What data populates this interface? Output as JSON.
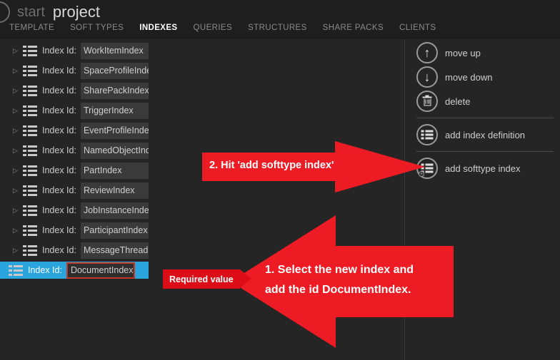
{
  "header": {
    "logo_icon": "circle-logo-icon",
    "title_prefix": "start",
    "title": "project",
    "tabs": [
      {
        "label": "TEMPLATE",
        "active": false
      },
      {
        "label": "SOFT TYPES",
        "active": false
      },
      {
        "label": "INDEXES",
        "active": true
      },
      {
        "label": "QUERIES",
        "active": false
      },
      {
        "label": "STRUCTURES",
        "active": false
      },
      {
        "label": "SHARE PACKS",
        "active": false
      },
      {
        "label": "CLIENTS",
        "active": false
      }
    ]
  },
  "index_list": {
    "row_label": "Index Id:",
    "rows": [
      {
        "value": "WorkItemIndex",
        "selected": false
      },
      {
        "value": "SpaceProfileIndex",
        "selected": false
      },
      {
        "value": "SharePackIndex",
        "selected": false
      },
      {
        "value": "TriggerIndex",
        "selected": false
      },
      {
        "value": "EventProfileIndex",
        "selected": false
      },
      {
        "value": "NamedObjectIndex",
        "selected": false
      },
      {
        "value": "PartIndex",
        "selected": false
      },
      {
        "value": "ReviewIndex",
        "selected": false
      },
      {
        "value": "JobInstanceIndex",
        "selected": false
      },
      {
        "value": "ParticipantIndex",
        "selected": false
      },
      {
        "value": "MessageThreadIndex",
        "selected": false
      },
      {
        "value": "DocumentIndex",
        "selected": true
      }
    ],
    "validation_message": "Required value"
  },
  "actions": {
    "groups": [
      [
        {
          "label": "move up",
          "icon": "arrow-up-icon"
        },
        {
          "label": "move down",
          "icon": "arrow-down-icon"
        },
        {
          "label": "delete",
          "icon": "trash-icon"
        }
      ],
      [
        {
          "label": "add index definition",
          "icon": "add-index-definition-icon"
        }
      ],
      [
        {
          "label": "add softtype index",
          "icon": "add-softtype-index-icon"
        }
      ]
    ]
  },
  "annotations": {
    "step2": {
      "text": "2. Hit 'add softtype index'",
      "direction": "right"
    },
    "step1": {
      "text": "1. Select the new index and\nadd the id DocumentIndex.",
      "direction": "left"
    }
  },
  "colors": {
    "background": "#252525",
    "header": "#1e1e1e",
    "selection": "#29a4dd",
    "annotation_red": "#ed1c24",
    "error_red": "#dc0d16",
    "input_bg": "#3a3a3a"
  }
}
